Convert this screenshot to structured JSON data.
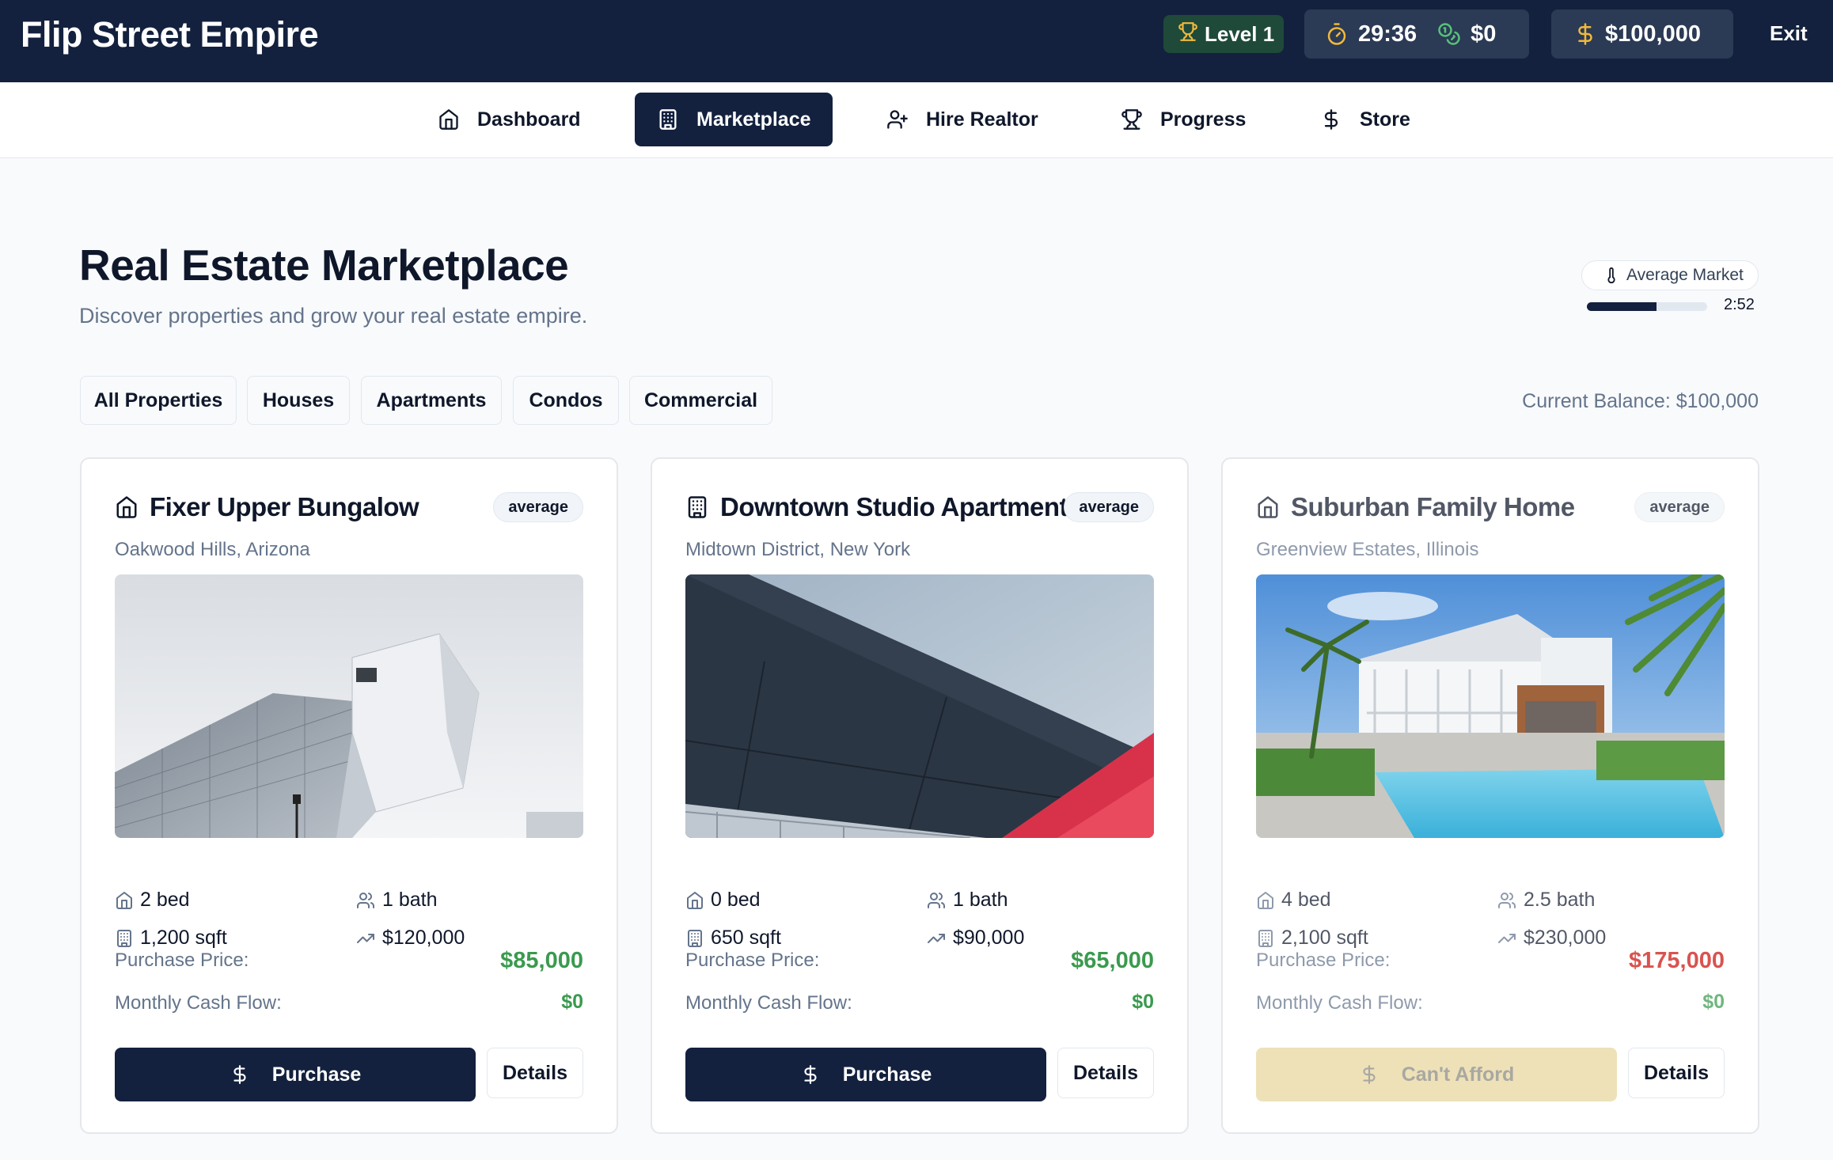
{
  "app": {
    "title": "Flip Street Empire"
  },
  "status": {
    "level": "Level 1",
    "timer": "29:36",
    "earned": "$0",
    "balance": "$100,000",
    "exit_label": "Exit"
  },
  "nav": [
    {
      "label": "Dashboard",
      "icon": "home-icon",
      "active": false
    },
    {
      "label": "Marketplace",
      "icon": "building-icon",
      "active": true
    },
    {
      "label": "Hire Realtor",
      "icon": "user-plus-icon",
      "active": false
    },
    {
      "label": "Progress",
      "icon": "trophy-icon",
      "active": false
    },
    {
      "label": "Store",
      "icon": "dollar-icon",
      "active": false
    }
  ],
  "page": {
    "title": "Real Estate Marketplace",
    "subtitle": "Discover properties and grow your real estate empire.",
    "market_label": "Average Market",
    "market_timer": "2:52",
    "market_progress": 0.58,
    "balance_text": "Current Balance: $100,000"
  },
  "filters": [
    "All Properties",
    "Houses",
    "Apartments",
    "Condos",
    "Commercial"
  ],
  "properties": [
    {
      "title": "Fixer Upper Bungalow",
      "type_icon": "house-icon",
      "badge": "average",
      "location": "Oakwood Hills, Arizona",
      "beds": "2 bed",
      "baths": "1 bath",
      "sqft": "1,200 sqft",
      "value": "$120,000",
      "price_label": "Purchase Price:",
      "price": "$85,000",
      "cash_label": "Monthly Cash Flow:",
      "cash": "$0",
      "action": "Purchase",
      "details": "Details",
      "affordable": true
    },
    {
      "title": "Downtown Studio Apartment",
      "type_icon": "building-icon",
      "badge": "average",
      "location": "Midtown District, New York",
      "beds": "0 bed",
      "baths": "1 bath",
      "sqft": "650 sqft",
      "value": "$90,000",
      "price_label": "Purchase Price:",
      "price": "$65,000",
      "cash_label": "Monthly Cash Flow:",
      "cash": "$0",
      "action": "Purchase",
      "details": "Details",
      "affordable": true
    },
    {
      "title": "Suburban Family Home",
      "type_icon": "house-icon",
      "badge": "average",
      "location": "Greenview Estates, Illinois",
      "beds": "4 bed",
      "baths": "2.5 bath",
      "sqft": "2,100 sqft",
      "value": "$230,000",
      "price_label": "Purchase Price:",
      "price": "$175,000",
      "cash_label": "Monthly Cash Flow:",
      "cash": "$0",
      "action": "Can't Afford",
      "details": "Details",
      "affordable": false
    }
  ],
  "colors": {
    "navy": "#13213e",
    "affordable_price": "#3a9a4e",
    "unaffordable_price": "#d9534f",
    "accent_gold": "#e8b43a",
    "accent_green": "#57c27a"
  }
}
